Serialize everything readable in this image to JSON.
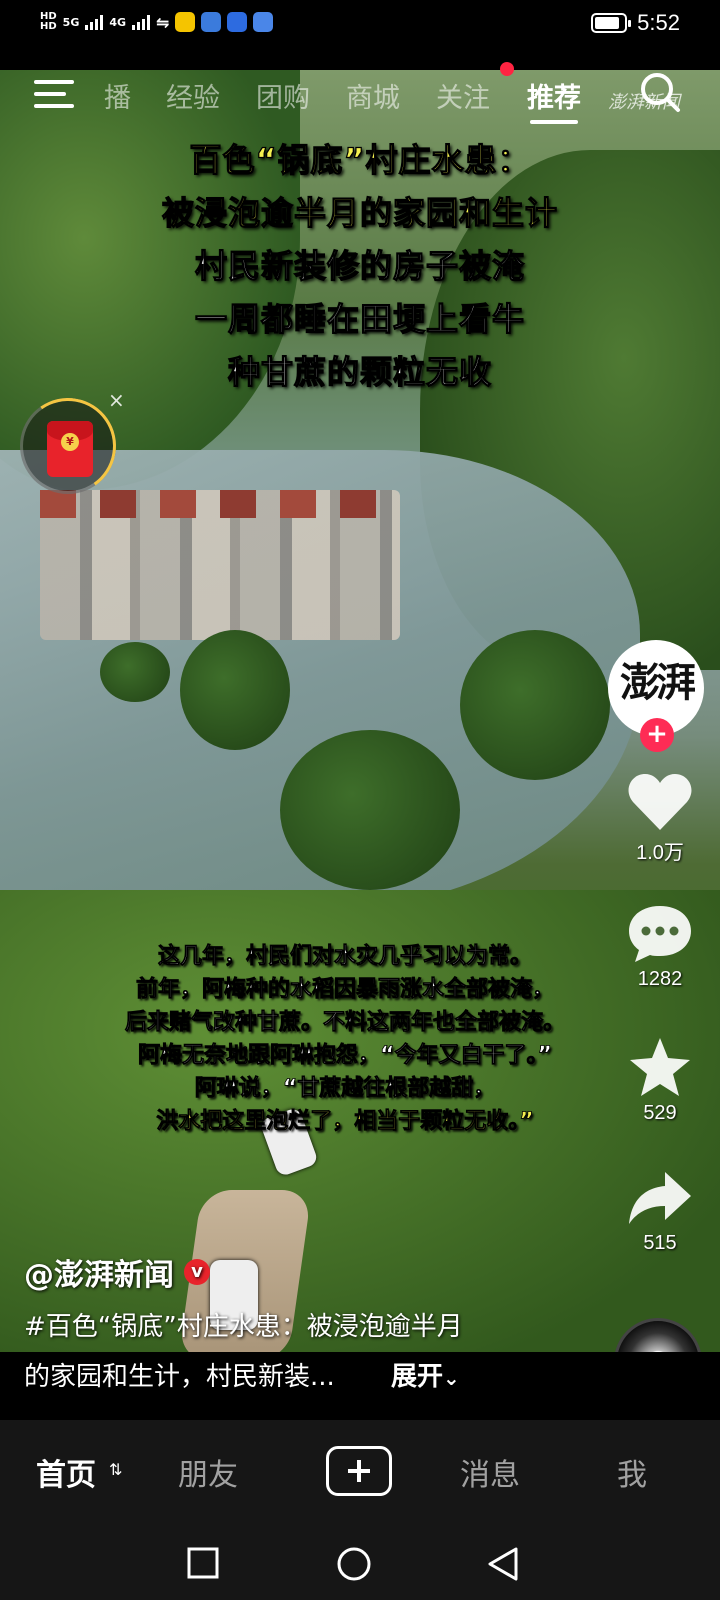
{
  "status_bar": {
    "sim1": "5G",
    "sim2": "4G",
    "time": "5:52"
  },
  "top_nav": {
    "tabs": [
      {
        "label": "播"
      },
      {
        "label": "经验"
      },
      {
        "label": "团购"
      },
      {
        "label": "商城"
      },
      {
        "label": "关注"
      },
      {
        "label": "推荐"
      }
    ],
    "active_tab": "推荐",
    "watermark": "澎湃新闻"
  },
  "headline": {
    "line1": "百色“锅底”村庄水患：",
    "line2": "被浸泡逾半月的家园和生计",
    "line3": "村民新装修的房子被淹",
    "line4": "一周都睡在田埂上看牛",
    "line5": "种甘蔗的颗粒无收"
  },
  "red_packet": {
    "coin_symbol": "¥",
    "close": "×"
  },
  "rail": {
    "logo_text": "澎湃",
    "likes": "1.0万",
    "comments": "1282",
    "favorites": "529",
    "shares": "515"
  },
  "subtitles": {
    "line1": "这几年，村民们对水灾几乎习以为常。",
    "line2": "前年，阿梅种的水稻因暴雨涨水全部被淹，",
    "line3": "后来赌气改种甘蔗。不料这两年也全部被淹。",
    "line4": "阿梅无奈地跟阿琳抱怨，“今年又白干了。”",
    "line5": "阿琳说，“甘蔗越往根部越甜，",
    "line6": "洪水把这里泡烂了，相当于颗粒无收。”"
  },
  "post": {
    "author": "@澎湃新闻",
    "caption_line1": "#百色“锅底”村庄水患：被浸泡逾半月",
    "caption_line2": "的家园和生计，村民新装...",
    "expand_label": "展开"
  },
  "bottom_nav": {
    "home": "首页",
    "friends": "朋友",
    "messages": "消息",
    "me": "我"
  },
  "colors": {
    "accent_red": "#fe2c55",
    "subtitle_yellow": "#f4f150"
  }
}
